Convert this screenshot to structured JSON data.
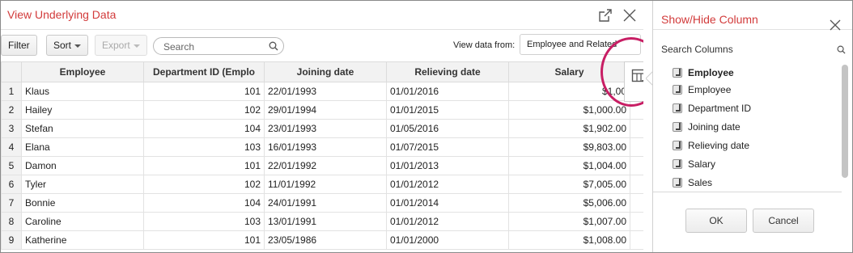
{
  "dialog": {
    "title": "View Underlying Data",
    "filter_label": "Filter",
    "sort_label": "Sort",
    "export_label": "Export",
    "search_placeholder": "Search",
    "view_from_label": "View data from:",
    "view_from_value": "Employee and Related"
  },
  "table": {
    "columns": [
      "Employee",
      "Department ID (Emplo",
      "Joining date",
      "Relieving date",
      "Salary"
    ],
    "rows": [
      {
        "n": "1",
        "employee": "Klaus",
        "dept": "101",
        "joining": "22/01/1993",
        "relieving": "01/01/2016",
        "salary": "$1,00"
      },
      {
        "n": "2",
        "employee": "Hailey",
        "dept": "102",
        "joining": "29/01/1994",
        "relieving": "01/01/2015",
        "salary": "$1,000.00"
      },
      {
        "n": "3",
        "employee": "Stefan",
        "dept": "104",
        "joining": "23/01/1993",
        "relieving": "01/05/2016",
        "salary": "$1,902.00"
      },
      {
        "n": "4",
        "employee": "Elana",
        "dept": "103",
        "joining": "16/01/1993",
        "relieving": "01/07/2015",
        "salary": "$9,803.00"
      },
      {
        "n": "5",
        "employee": "Damon",
        "dept": "101",
        "joining": "22/01/1992",
        "relieving": "01/01/2013",
        "salary": "$1,004.00"
      },
      {
        "n": "6",
        "employee": "Tyler",
        "dept": "102",
        "joining": "11/01/1992",
        "relieving": "01/01/2012",
        "salary": "$7,005.00"
      },
      {
        "n": "7",
        "employee": "Bonnie",
        "dept": "104",
        "joining": "24/01/1991",
        "relieving": "01/01/2014",
        "salary": "$5,006.00"
      },
      {
        "n": "8",
        "employee": "Caroline",
        "dept": "103",
        "joining": "13/01/1991",
        "relieving": "01/01/2012",
        "salary": "$1,007.00"
      },
      {
        "n": "9",
        "employee": "Katherine",
        "dept": "101",
        "joining": "23/05/1986",
        "relieving": "01/01/2000",
        "salary": "$1,008.00"
      }
    ]
  },
  "panel": {
    "title": "Show/Hide Column",
    "search_placeholder": "Search Columns",
    "group_label": "Employee",
    "columns": [
      "Employee",
      "Department ID",
      "Joining date",
      "Relieving date",
      "Salary",
      "Sales"
    ],
    "ok_label": "OK",
    "cancel_label": "Cancel"
  },
  "colors": {
    "title_red": "#d23b3b",
    "highlight_ring": "#c81e64"
  },
  "icons": [
    "open-external-icon",
    "close-icon",
    "column-chooser-icon",
    "search-icon"
  ]
}
